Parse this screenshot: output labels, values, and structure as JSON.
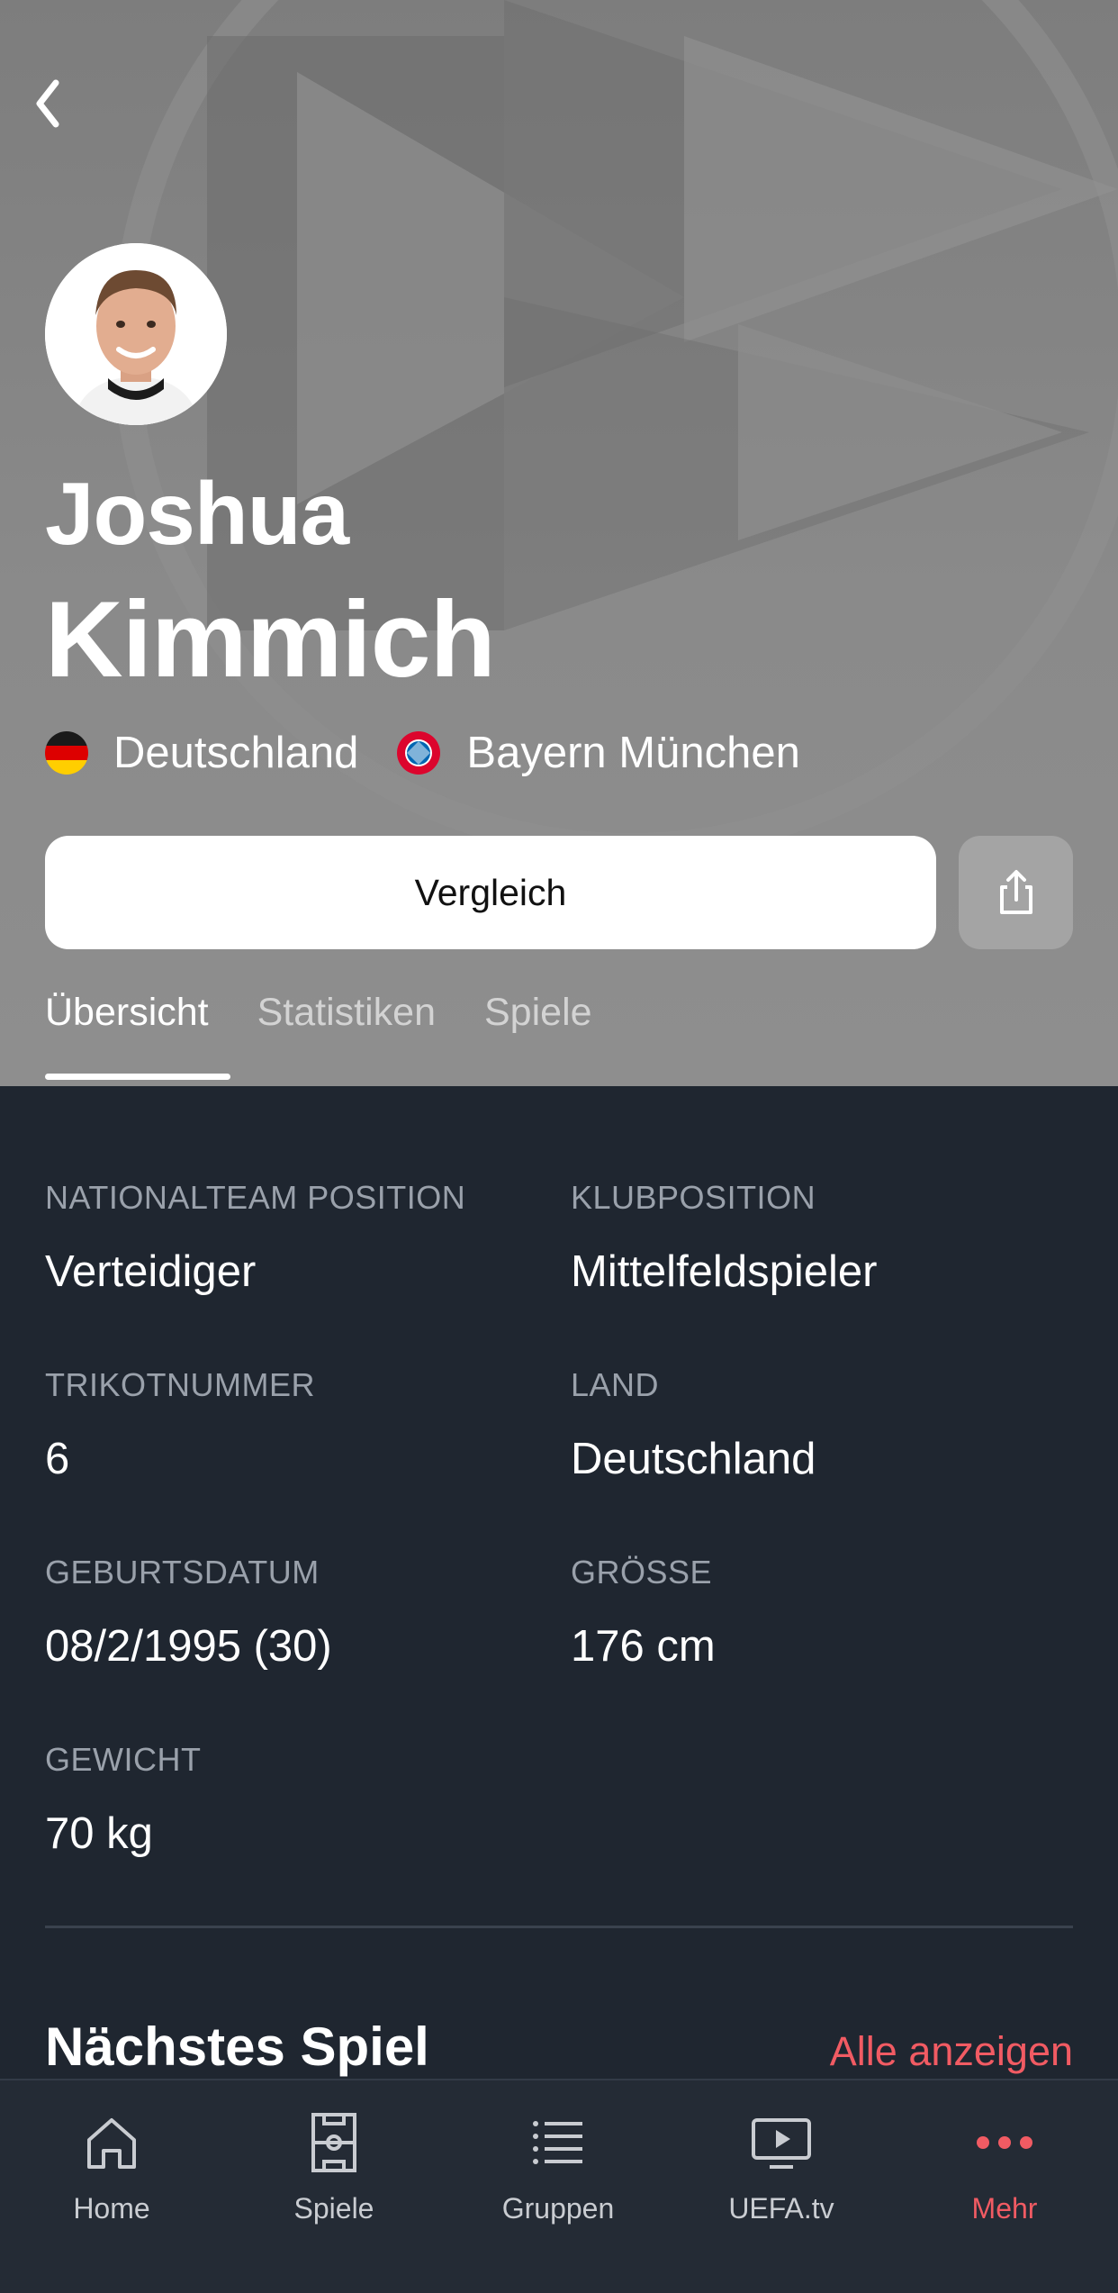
{
  "player": {
    "first_name": "Joshua",
    "last_name": "Kimmich",
    "country": "Deutschland",
    "club": "Bayern München"
  },
  "actions": {
    "compare_label": "Vergleich"
  },
  "tabs": [
    {
      "label": "Übersicht",
      "active": true
    },
    {
      "label": "Statistiken",
      "active": false
    },
    {
      "label": "Spiele",
      "active": false
    }
  ],
  "info": {
    "national_position_label": "NATIONALTEAM POSITION",
    "national_position": "Verteidiger",
    "club_position_label": "KLUBPOSITION",
    "club_position": "Mittelfeldspieler",
    "shirt_label": "TRIKOTNUMMER",
    "shirt_number": "6",
    "country_label": "LAND",
    "country": "Deutschland",
    "birth_label": "GEBURTSDATUM",
    "birth_date": "08/2/1995 (30)",
    "height_label": "GRÖSSE",
    "height": "176 cm",
    "weight_label": "GEWICHT",
    "weight": "70 kg"
  },
  "next_match": {
    "title": "Nächstes Spiel",
    "see_all": "Alle anzeigen"
  },
  "bottom_nav": [
    {
      "label": "Home",
      "icon": "home-icon"
    },
    {
      "label": "Spiele",
      "icon": "pitch-icon"
    },
    {
      "label": "Gruppen",
      "icon": "list-icon"
    },
    {
      "label": "UEFA.tv",
      "icon": "tv-play-icon"
    },
    {
      "label": "Mehr",
      "icon": "more-dots-icon",
      "active": true
    }
  ],
  "colors": {
    "accent": "#f15b63",
    "background": "#1f2630",
    "hero": "#8a8a8a"
  }
}
